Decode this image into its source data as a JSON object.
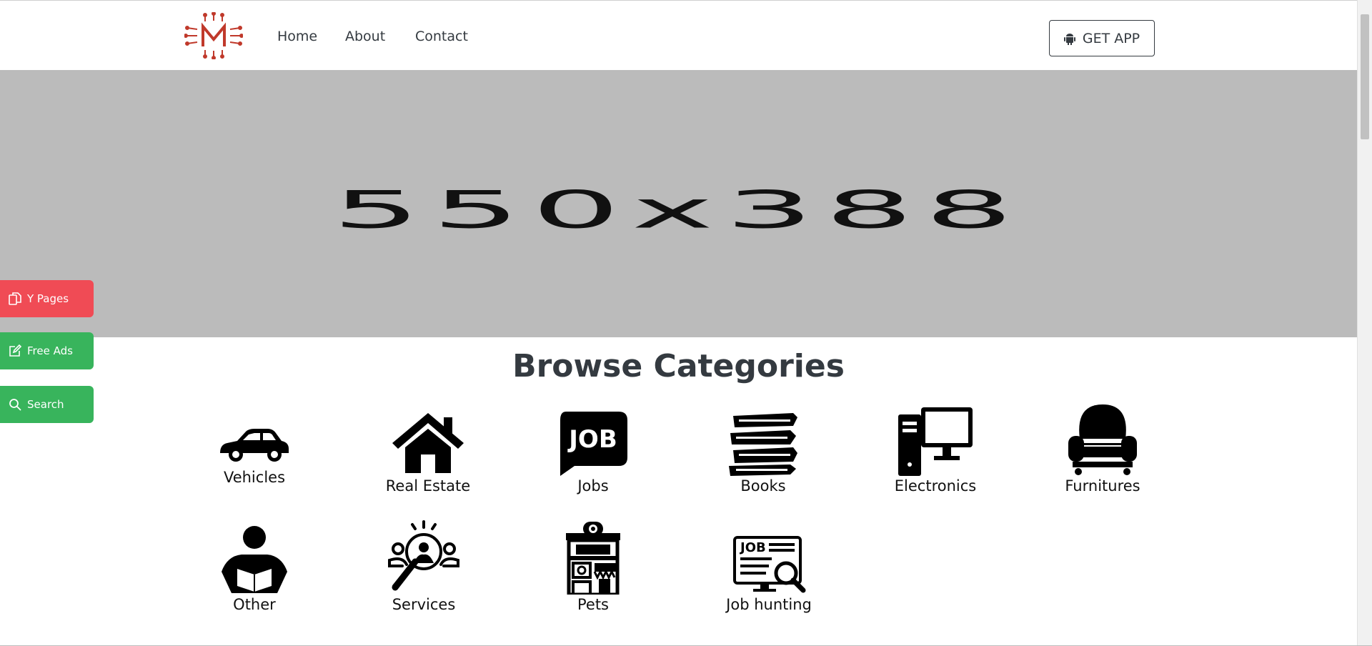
{
  "nav": {
    "links": [
      "Home",
      "About",
      "Contact"
    ],
    "get_app_label": "GET APP"
  },
  "banner": {
    "placeholder_text": "550x388",
    "background": "#bbbbbb"
  },
  "side_buttons": {
    "ypages": "Y Pages",
    "free_ads": "Free Ads",
    "search": "Search"
  },
  "section": {
    "title": "Browse Categories"
  },
  "categories": [
    {
      "label": "Vehicles",
      "icon": "car-icon"
    },
    {
      "label": "Real Estate",
      "icon": "house-icon"
    },
    {
      "label": "Jobs",
      "icon": "job-bubble-icon"
    },
    {
      "label": "Books",
      "icon": "books-icon"
    },
    {
      "label": "Electronics",
      "icon": "computer-icon"
    },
    {
      "label": "Furnitures",
      "icon": "armchair-icon"
    },
    {
      "label": "Other",
      "icon": "reader-icon"
    },
    {
      "label": "Services",
      "icon": "user-search-icon"
    },
    {
      "label": "Pets",
      "icon": "pet-shop-icon"
    },
    {
      "label": "Job hunting",
      "icon": "job-search-icon"
    }
  ],
  "colors": {
    "accent_red": "#f04b55",
    "accent_green": "#38b45c",
    "logo_red": "#c0392b",
    "text_dark": "#343a40"
  }
}
